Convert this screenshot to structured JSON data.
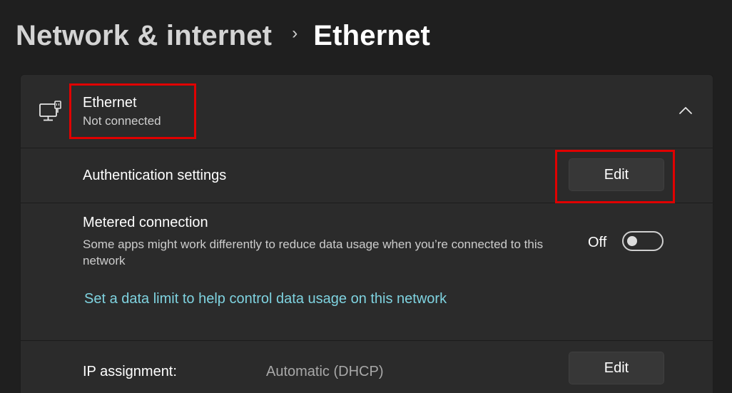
{
  "breadcrumb": {
    "parent": "Network & internet",
    "separator": "›",
    "current": "Ethernet"
  },
  "ethernet_card": {
    "icon": "ethernet-monitor-icon",
    "title": "Ethernet",
    "status": "Not connected",
    "collapse_icon": "chevron-up-icon"
  },
  "authentication": {
    "label": "Authentication settings",
    "button_label": "Edit"
  },
  "metered": {
    "label": "Metered connection",
    "description": "Some apps might work differently to reduce data usage when you’re connected to this network",
    "toggle_label": "Off",
    "toggle_on": false,
    "data_limit_link": "Set a data limit to help control data usage on this network"
  },
  "ip_assignment": {
    "label": "IP assignment:",
    "value": "Automatic (DHCP)",
    "button_label": "Edit"
  },
  "colors": {
    "background": "#1f1f1f",
    "card": "#2b2b2b",
    "button": "#373737",
    "link": "#7fd3e0",
    "highlight": "#e00000"
  }
}
